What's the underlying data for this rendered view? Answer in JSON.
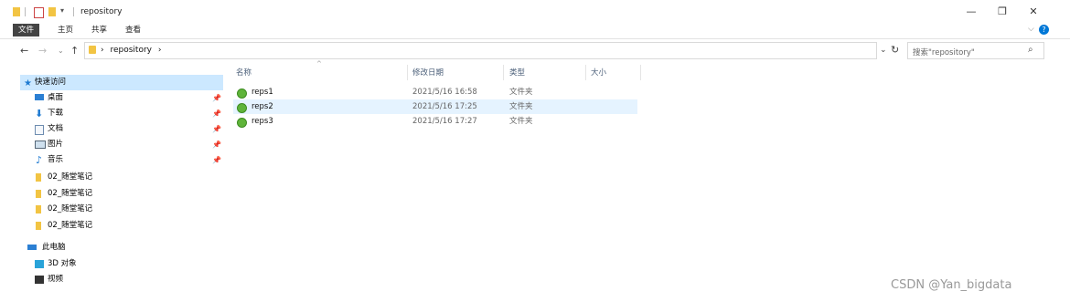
{
  "window": {
    "title": "repository",
    "minimize": "—",
    "restore": "❐",
    "close": "✕"
  },
  "ribbon": {
    "tabs": [
      "文件",
      "主页",
      "共享",
      "查看"
    ]
  },
  "address": {
    "path": "repository",
    "separator": "›",
    "refresh": "↻",
    "dropdown": "⌄"
  },
  "search": {
    "placeholder": "搜索\"repository\""
  },
  "nav": {
    "quick_access": "快速访问",
    "items": [
      {
        "label": "桌面",
        "pinned": true
      },
      {
        "label": "下载",
        "pinned": true
      },
      {
        "label": "文档",
        "pinned": true
      },
      {
        "label": "图片",
        "pinned": true
      },
      {
        "label": "音乐",
        "pinned": true
      },
      {
        "label": "02_随堂笔记",
        "pinned": false
      },
      {
        "label": "02_随堂笔记",
        "pinned": false
      },
      {
        "label": "02_随堂笔记",
        "pinned": false
      },
      {
        "label": "02_随堂笔记",
        "pinned": false
      }
    ],
    "this_pc": "此电脑",
    "pc_items": [
      "3D 对象",
      "视频"
    ]
  },
  "columns": {
    "name": "名称",
    "date": "修改日期",
    "type": "类型",
    "size": "大小"
  },
  "files": [
    {
      "name": "reps1",
      "date": "2021/5/16 16:58",
      "type": "文件夹"
    },
    {
      "name": "reps2",
      "date": "2021/5/16 17:25",
      "type": "文件夹"
    },
    {
      "name": "reps3",
      "date": "2021/5/16 17:27",
      "type": "文件夹"
    }
  ],
  "watermark": "CSDN @Yan_bigdata",
  "colors": {
    "selected_nav": "#cce8ff",
    "selected_row": "#e5f3ff",
    "folder": "#f2c443",
    "accent": "#0078d7"
  }
}
